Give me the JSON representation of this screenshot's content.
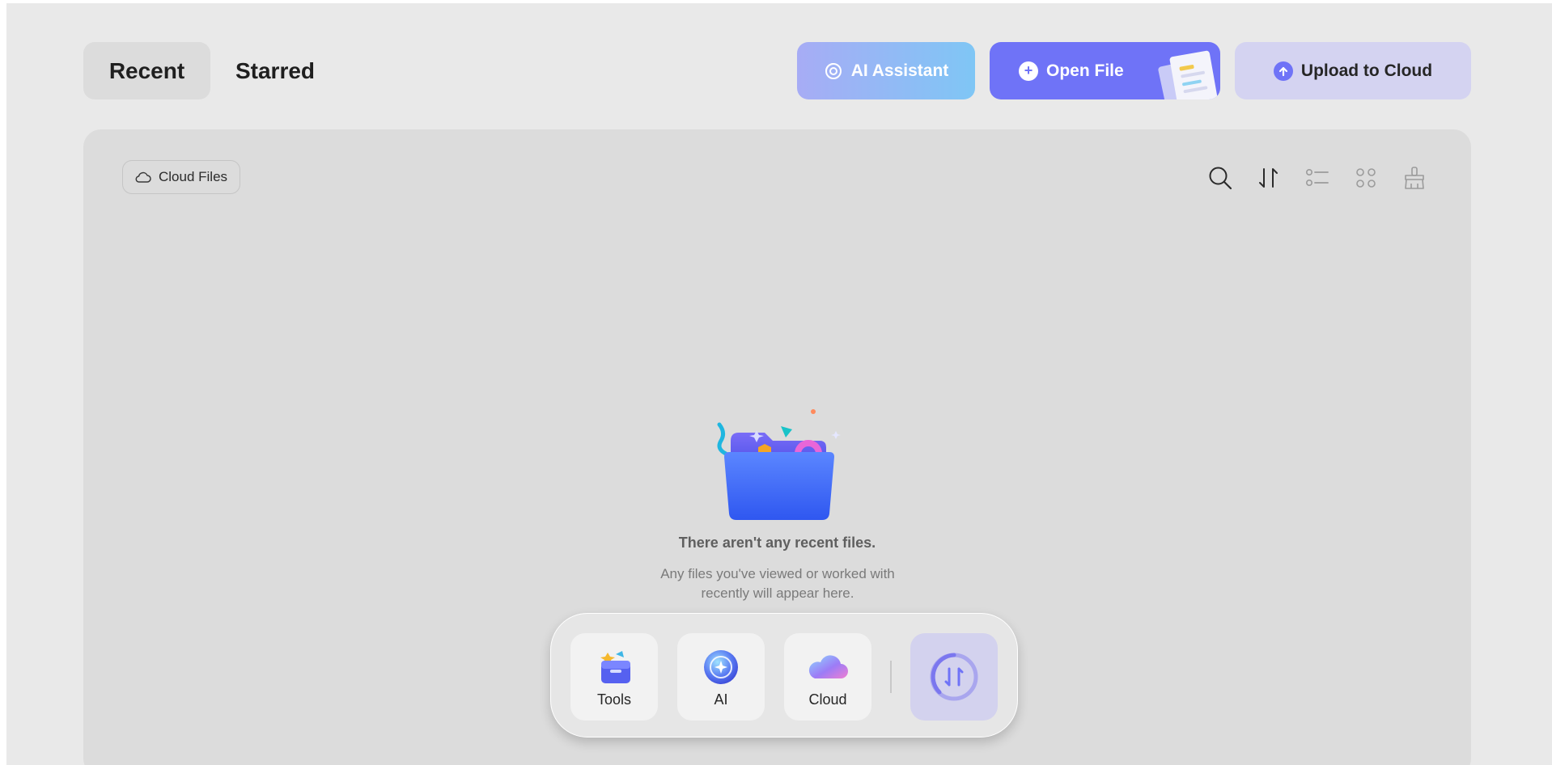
{
  "tabs": {
    "recent": "Recent",
    "starred": "Starred",
    "active": "Recent"
  },
  "actions": {
    "ai_assistant": "AI Assistant",
    "open_file": "Open File",
    "upload_to_cloud": "Upload to Cloud"
  },
  "panel": {
    "cloud_files": "Cloud Files",
    "toolbar_icons": [
      "search-icon",
      "sort-icon",
      "list-view-icon",
      "grid-view-icon",
      "clean-brush-icon"
    ]
  },
  "empty_state": {
    "title": "There aren't any recent files.",
    "subtitle": "Any files you've viewed or worked with recently will appear here."
  },
  "dock": {
    "items": [
      {
        "label": "Tools",
        "icon": "toolbox-icon"
      },
      {
        "label": "AI",
        "icon": "ai-orb-icon"
      },
      {
        "label": "Cloud",
        "icon": "cloud-icon"
      }
    ],
    "switch_icon": "switch-arrows-icon"
  },
  "colors": {
    "accent": "#6f73f7",
    "background": "#e9e9e9",
    "panel": "#dcdcdc"
  }
}
